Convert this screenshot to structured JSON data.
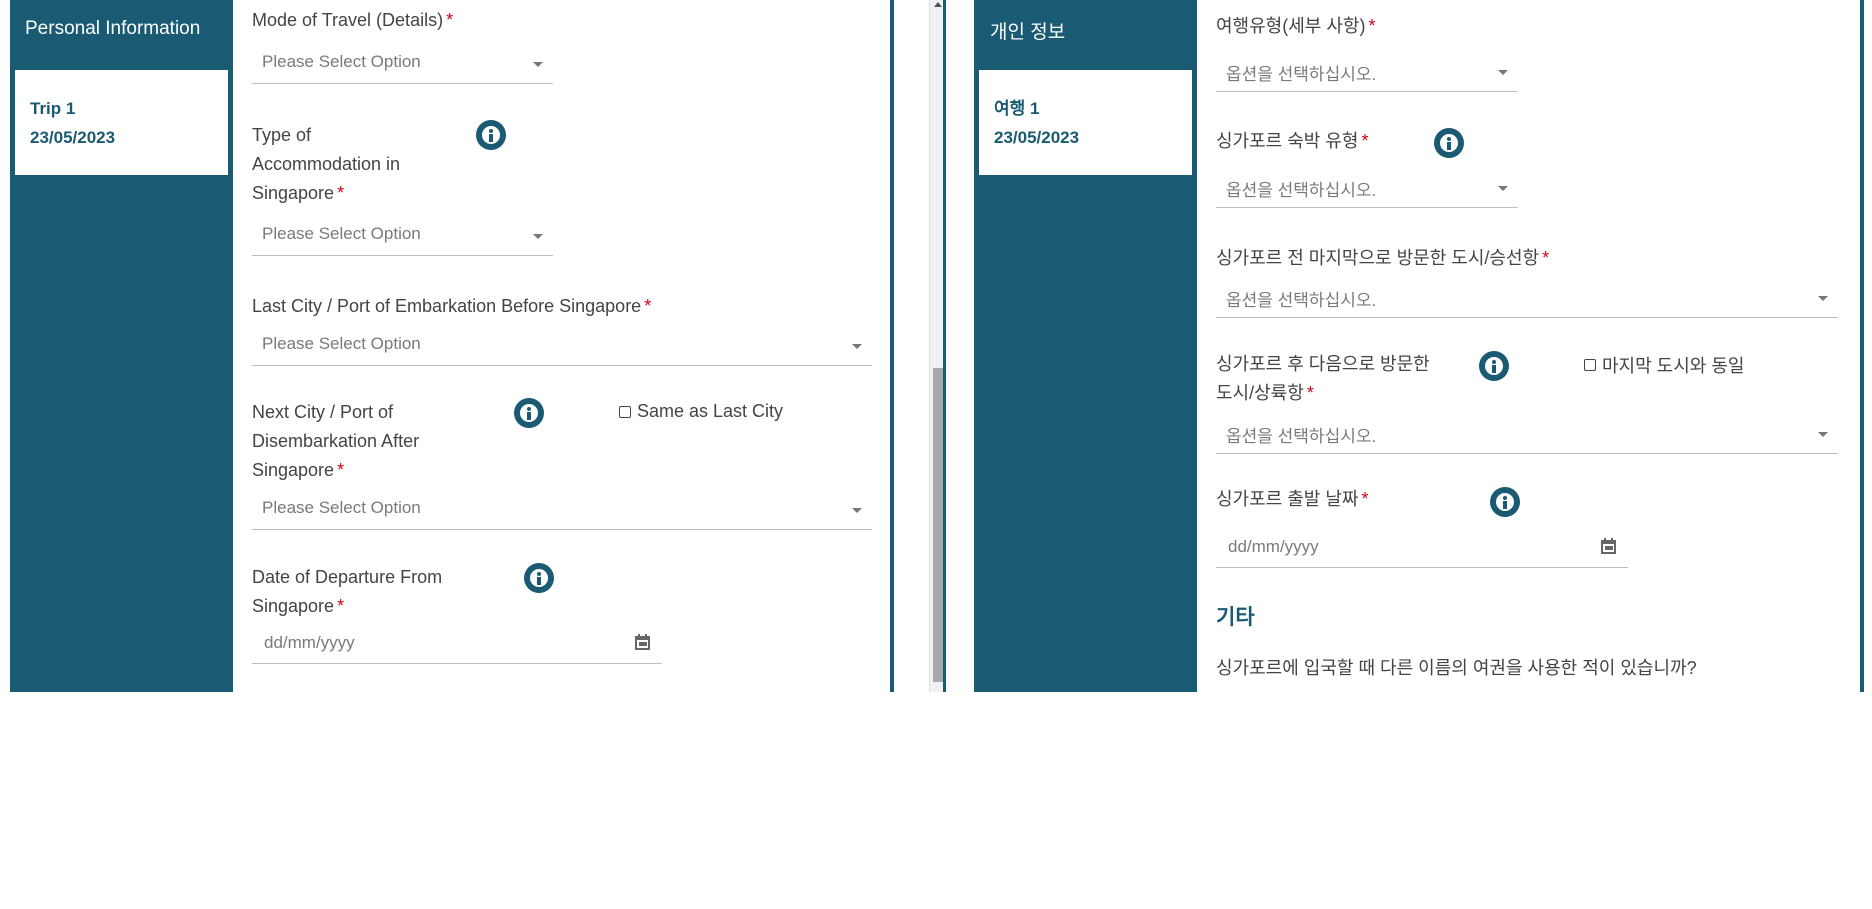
{
  "english": {
    "sidebar": {
      "title": "Personal Information",
      "trip_name": "Trip 1",
      "trip_date": "23/05/2023"
    },
    "mode_travel": {
      "label": "Mode of Travel (Details)",
      "placeholder": "Please Select Option"
    },
    "accommodation": {
      "label_line1": "Type of",
      "label_line2": "Accommodation in",
      "label_line3": "Singapore",
      "placeholder": "Please Select Option"
    },
    "last_city": {
      "label": "Last City / Port of Embarkation Before Singapore",
      "placeholder": "Please Select Option"
    },
    "next_city": {
      "label_line1": "Next City / Port of",
      "label_line2": "Disembarkation After",
      "label_line3": "Singapore",
      "placeholder": "Please Select Option",
      "same_as_last": "Same as Last City"
    },
    "departure": {
      "label_line1": "Date of Departure From",
      "label_line2": "Singapore",
      "placeholder": "dd/mm/yyyy"
    },
    "required_mark": "*"
  },
  "korean": {
    "sidebar": {
      "title": "개인 정보",
      "trip_name": "여행 1",
      "trip_date": "23/05/2023"
    },
    "mode_travel": {
      "label": "여행유형(세부 사항)",
      "placeholder": "옵션을 선택하십시오."
    },
    "accommodation": {
      "label": "싱가포르 숙박 유형",
      "placeholder": "옵션을 선택하십시오."
    },
    "last_city": {
      "label": "싱가포르 전 마지막으로 방문한 도시/승선항",
      "placeholder": "옵션을 선택하십시오."
    },
    "next_city": {
      "label_line1": "싱가포르 후 다음으로 방문한",
      "label_line2": "도시/상륙항",
      "placeholder": "옵션을 선택하십시오.",
      "same_as_last": "마지막 도시와 동일"
    },
    "departure": {
      "label": "싱가포르 출발 날짜",
      "placeholder": "dd/mm/yyyy"
    },
    "other_heading": "기타",
    "passport_question": "싱가포르에 입국할 때 다른 이름의 여권을 사용한 적이 있습니까?",
    "required_mark": "*"
  },
  "colors": {
    "primary": "#1a5a73",
    "required": "#d0021b",
    "text": "#444444",
    "placeholder": "#7a7a7a"
  }
}
